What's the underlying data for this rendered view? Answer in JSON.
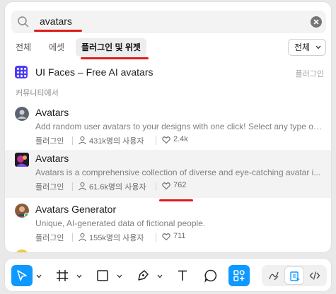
{
  "search": {
    "value": "avatars",
    "placeholder": ""
  },
  "tabs": [
    {
      "label": "전체",
      "active": false
    },
    {
      "label": "에셋",
      "active": false
    },
    {
      "label": "플러그인 및 위젯",
      "active": true
    }
  ],
  "filter": {
    "selected": "전체"
  },
  "featured": {
    "title": "UI Faces – Free AI avatars",
    "type": "플러그인"
  },
  "section_label": "커뮤니티에서",
  "results": [
    {
      "title": "Avatars",
      "description": "Add random user avatars to your designs with one click! Select any type of ...",
      "type": "플러그인",
      "users": "431k명의 사용자",
      "likes": "2.4k"
    },
    {
      "title": "Avatars",
      "description": "Avatars is a comprehensive collection of diverse and eye-catching avatar i...",
      "type": "플러그인",
      "users": "61.6k명의 사용자",
      "likes": "762"
    },
    {
      "title": "Avatars Generator",
      "description": "Unique, AI-generated data of fictional people.",
      "type": "플러그인",
      "users": "155k명의 사용자",
      "likes": "711"
    }
  ],
  "toolbar": {
    "tools": [
      "move-tool",
      "frame-tool",
      "shape-tool",
      "pen-tool",
      "text-tool",
      "comment-tool",
      "actions-tool"
    ],
    "active_tool": "move-tool",
    "modes": [
      "draw-mode",
      "design-mode",
      "dev-mode"
    ],
    "active_mode": "design-mode"
  },
  "colors": {
    "accent": "#0d99ff",
    "annotation": "#e01b1b"
  }
}
